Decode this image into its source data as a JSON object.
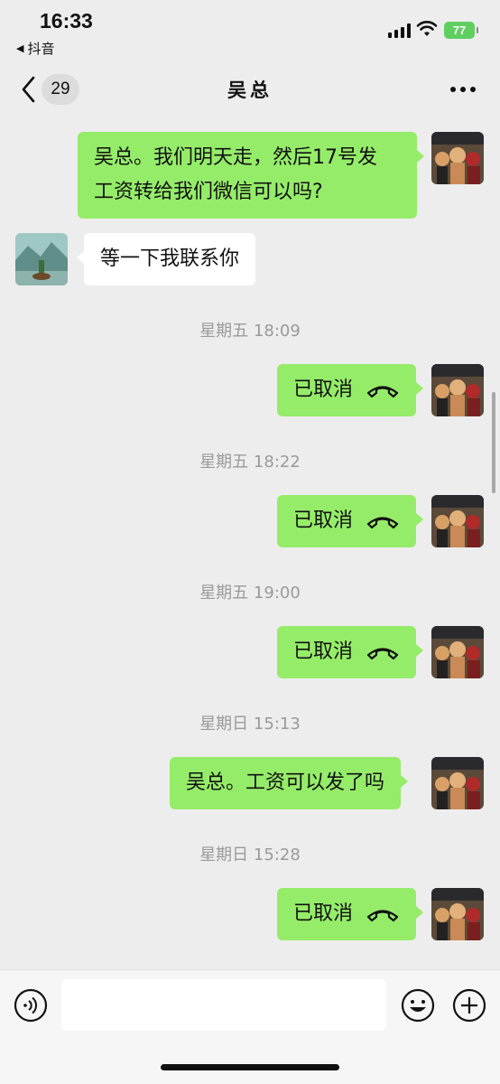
{
  "status_bar": {
    "time": "16:33",
    "back_app": "抖音",
    "battery": "77",
    "battery_color": "#5fcf5f"
  },
  "nav": {
    "unread_count": "29",
    "title": "吴总",
    "back_icon": "chevron-left-icon",
    "more_icon": "more-dots-icon"
  },
  "messages": [
    {
      "type": "text",
      "direction": "out",
      "text_line1": "吴总。我们明天走，然后17号发",
      "text_line2": "工资转给我们微信可以吗?"
    },
    {
      "type": "text",
      "direction": "in",
      "text": "等一下我联系你"
    },
    {
      "type": "timestamp",
      "text": "星期五 18:09"
    },
    {
      "type": "call",
      "direction": "out",
      "text": "已取消"
    },
    {
      "type": "timestamp",
      "text": "星期五 18:22"
    },
    {
      "type": "call",
      "direction": "out",
      "text": "已取消"
    },
    {
      "type": "timestamp",
      "text": "星期五 19:00"
    },
    {
      "type": "call",
      "direction": "out",
      "text": "已取消"
    },
    {
      "type": "timestamp",
      "text": "星期日 15:13"
    },
    {
      "type": "text",
      "direction": "out",
      "text": "吴总。工资可以发了吗"
    },
    {
      "type": "timestamp",
      "text": "星期日 15:28"
    },
    {
      "type": "call",
      "direction": "out",
      "text": "已取消"
    }
  ],
  "colors": {
    "outgoing_bubble": "#95ec69",
    "incoming_bubble": "#ffffff",
    "background": "#ededed"
  },
  "input_bar": {
    "voice_icon": "voice-icon",
    "emoji_icon": "emoji-icon",
    "plus_icon": "plus-icon"
  }
}
